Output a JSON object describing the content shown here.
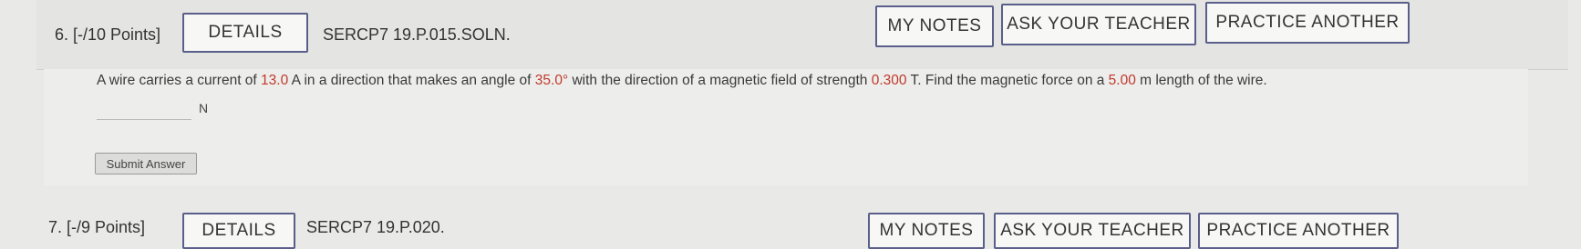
{
  "question6": {
    "number_label": "6.  [-/10 Points]",
    "details_label": "DETAILS",
    "code": "SERCP7 19.P.015.SOLN.",
    "my_notes_label": "MY NOTES",
    "ask_teacher_label": "ASK YOUR TEACHER",
    "practice_label": "PRACTICE ANOTHER",
    "text_1": "A wire carries a current of ",
    "current": "13.0",
    "text_2": " A in a direction that makes an angle of ",
    "angle": "35.0°",
    "text_3": " with the direction of a magnetic field of strength ",
    "field": "0.300",
    "text_4": " T. Find the magnetic force on a ",
    "length": "5.00",
    "text_5": " m length of the wire.",
    "answer_value": "",
    "unit": "N",
    "submit_label": "Submit Answer"
  },
  "question7": {
    "number_label": "7.  [-/9 Points]",
    "details_label": "DETAILS",
    "code": "SERCP7 19.P.020.",
    "my_notes_label": "MY NOTES",
    "ask_teacher_label": "ASK YOUR TEACHER",
    "practice_label": "PRACTICE ANOTHER"
  },
  "colors": {
    "button_border": "#5a5f8a",
    "value_red": "#c0392b",
    "background": "#e9e9e7"
  }
}
